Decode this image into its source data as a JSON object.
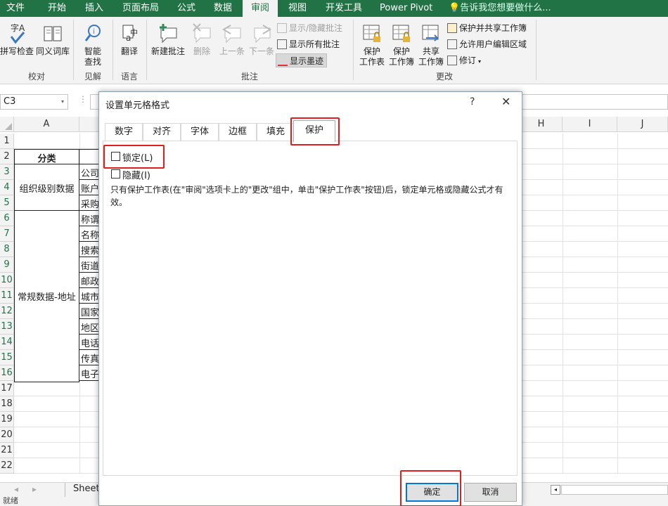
{
  "ribbon_tabs": [
    "文件",
    "开始",
    "插入",
    "页面布局",
    "公式",
    "数据",
    "审阅",
    "视图",
    "开发工具",
    "Power Pivot"
  ],
  "active_tab": "审阅",
  "tell_me": "告诉我您想要做什么...",
  "ribbon": {
    "spell": "拼写检查",
    "thesaurus": "同义词库",
    "smart_lookup_1": "智能",
    "smart_lookup_2": "查找",
    "translate": "翻译",
    "new_comment": "新建批注",
    "delete": "删除",
    "prev": "上一条",
    "next": "下一条",
    "show_hide_comment": "显示/隐藏批注",
    "show_all_comments": "显示所有批注",
    "show_ink": "显示墨迹",
    "protect_sheet_1": "保护",
    "protect_sheet_2": "工作表",
    "protect_wb_1": "保护",
    "protect_wb_2": "工作簿",
    "share_wb_1": "共享",
    "share_wb_2": "工作簿",
    "protect_share": "保护并共享工作簿",
    "allow_edit": "允许用户编辑区域",
    "track": "修订",
    "groups": {
      "proofing": "校对",
      "insights": "见解",
      "language": "语言",
      "comments": "批注",
      "changes": "更改"
    }
  },
  "name_box": "C3",
  "columns": [
    "A",
    "H",
    "I",
    "J"
  ],
  "rows": [
    "1",
    "2",
    "3",
    "4",
    "5",
    "6",
    "7",
    "8",
    "9",
    "10",
    "11",
    "12",
    "13",
    "14",
    "15",
    "16",
    "17",
    "18",
    "19",
    "20",
    "21",
    "22"
  ],
  "cells": {
    "header": "分类",
    "org_level": "组织级别数据",
    "regular_address": "常规数据-地址",
    "b_values": [
      "公司",
      "账户",
      "采购",
      "称谓",
      "名称",
      "搜索",
      "街道",
      "邮政",
      "城市",
      "国家",
      "地区",
      "电话",
      "传真",
      "电子"
    ]
  },
  "sheet_tab": "Sheet",
  "status": "就绪",
  "dialog": {
    "title": "设置单元格格式",
    "help": "?",
    "close": "✕",
    "tabs": [
      "数字",
      "对齐",
      "字体",
      "边框",
      "填充",
      "保护"
    ],
    "active_tab": "保护",
    "locked_label": "锁定(L)",
    "locked_checked": false,
    "hidden_label": "隐藏(I)",
    "hidden_checked": false,
    "description": "只有保护工作表(在\"审阅\"选项卡上的\"更改\"组中，单击\"保护工作表\"按钮)后，锁定单元格或隐藏公式才有效。",
    "ok": "确定",
    "cancel": "取消"
  },
  "colors": {
    "ribbon_green": "#217346",
    "highlight_red": "#e01e1e"
  }
}
